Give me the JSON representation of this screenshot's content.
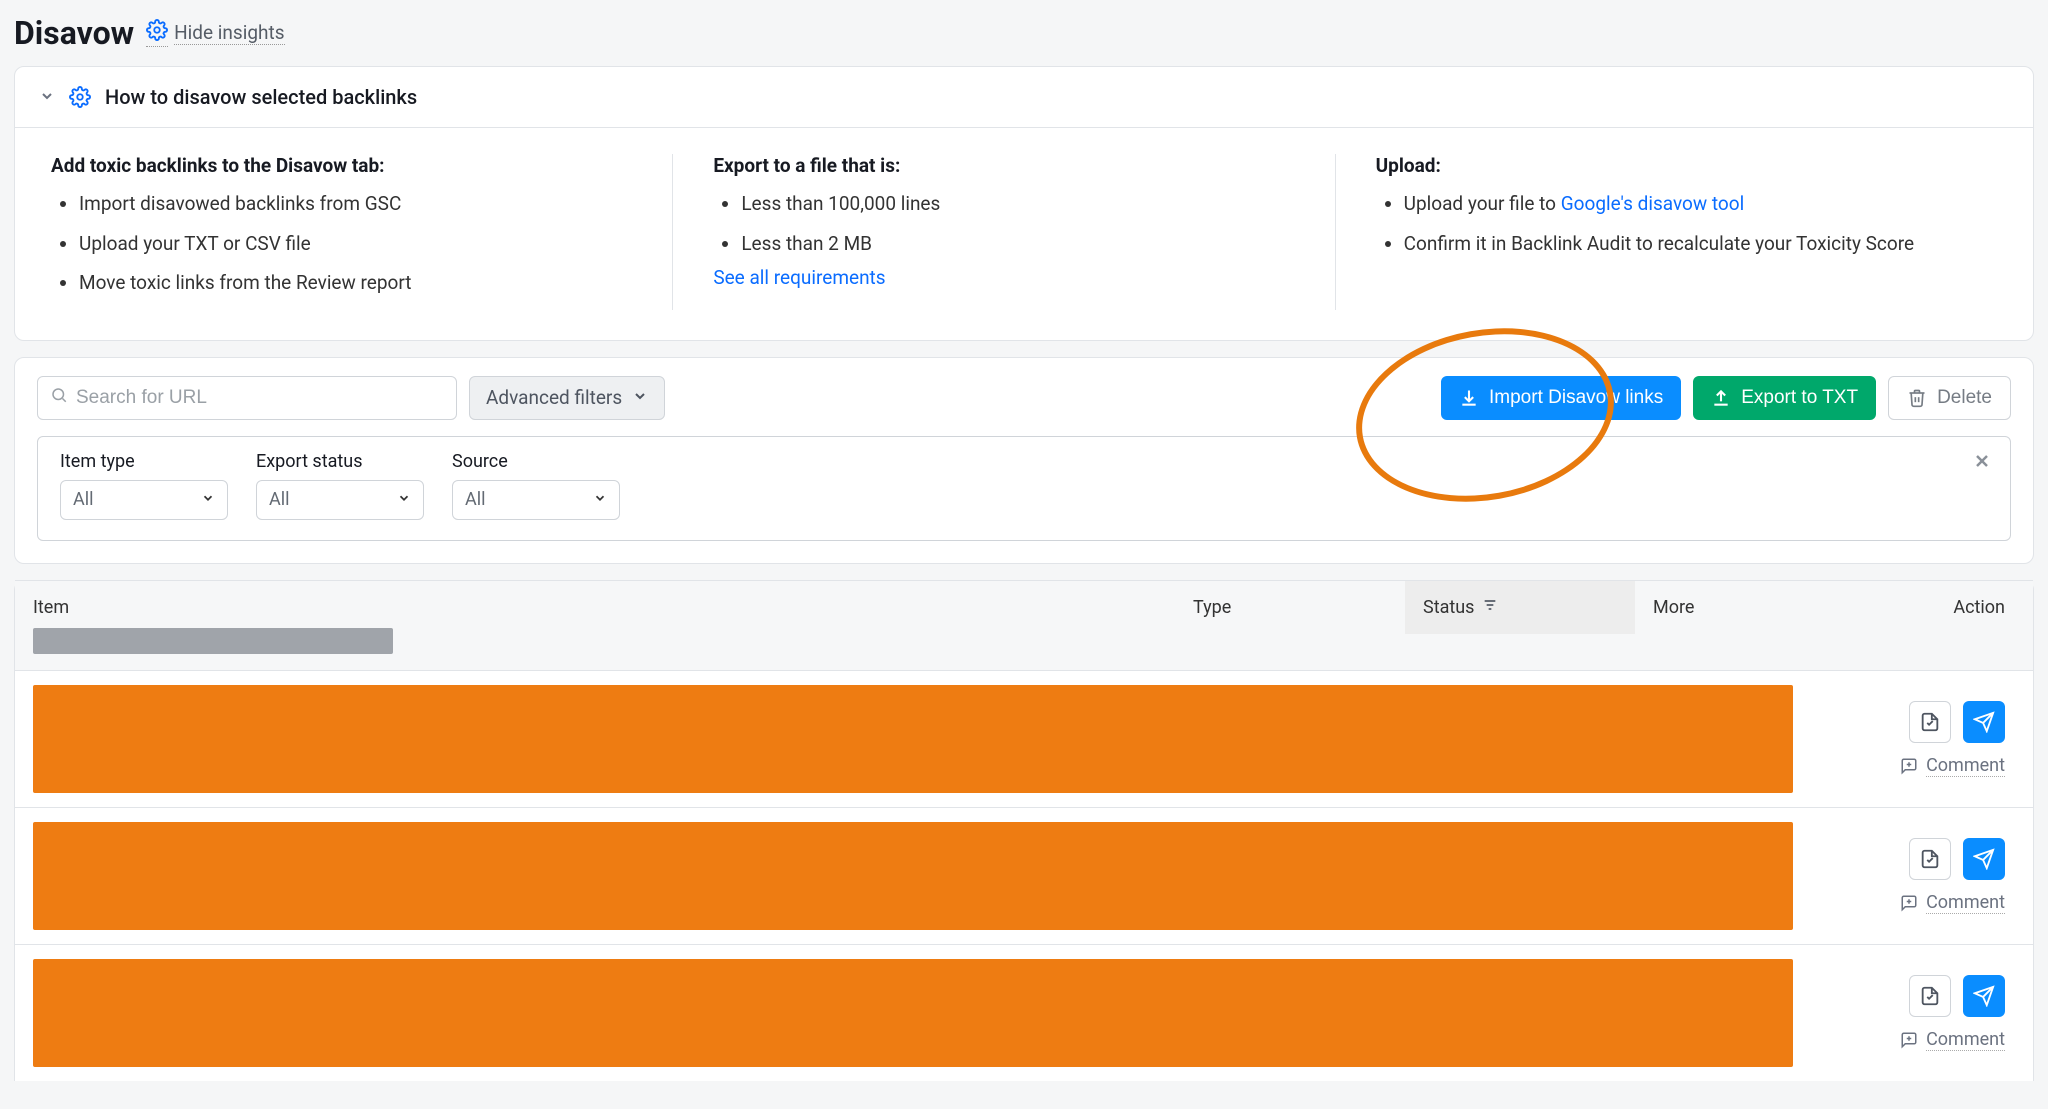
{
  "header": {
    "title": "Disavow",
    "hide_insights": "Hide insights"
  },
  "insights": {
    "title": "How to disavow selected backlinks",
    "col1": {
      "title": "Add toxic backlinks to the Disavow tab:",
      "items": [
        "Import disavowed backlinks from GSC",
        "Upload your TXT or CSV file",
        "Move toxic links from the Review report"
      ]
    },
    "col2": {
      "title": "Export to a file that is:",
      "items": [
        "Less than 100,000 lines",
        "Less than 2 MB"
      ],
      "see_all": "See all requirements"
    },
    "col3": {
      "title": "Upload:",
      "item1_prefix": "Upload your file to ",
      "item1_link": "Google's disavow tool",
      "item2": "Confirm it in Backlink Audit to recalculate your Toxicity Score"
    }
  },
  "toolbar": {
    "search_placeholder": "Search for URL",
    "advanced_filters": "Advanced filters",
    "import": "Import Disavow links",
    "export": "Export to TXT",
    "delete": "Delete"
  },
  "filters": {
    "item_type": {
      "label": "Item type",
      "value": "All"
    },
    "export_status": {
      "label": "Export status",
      "value": "All"
    },
    "source": {
      "label": "Source",
      "value": "All"
    }
  },
  "table": {
    "headers": {
      "item": "Item",
      "type": "Type",
      "status": "Status",
      "more": "More",
      "action": "Action"
    },
    "comment": "Comment"
  }
}
